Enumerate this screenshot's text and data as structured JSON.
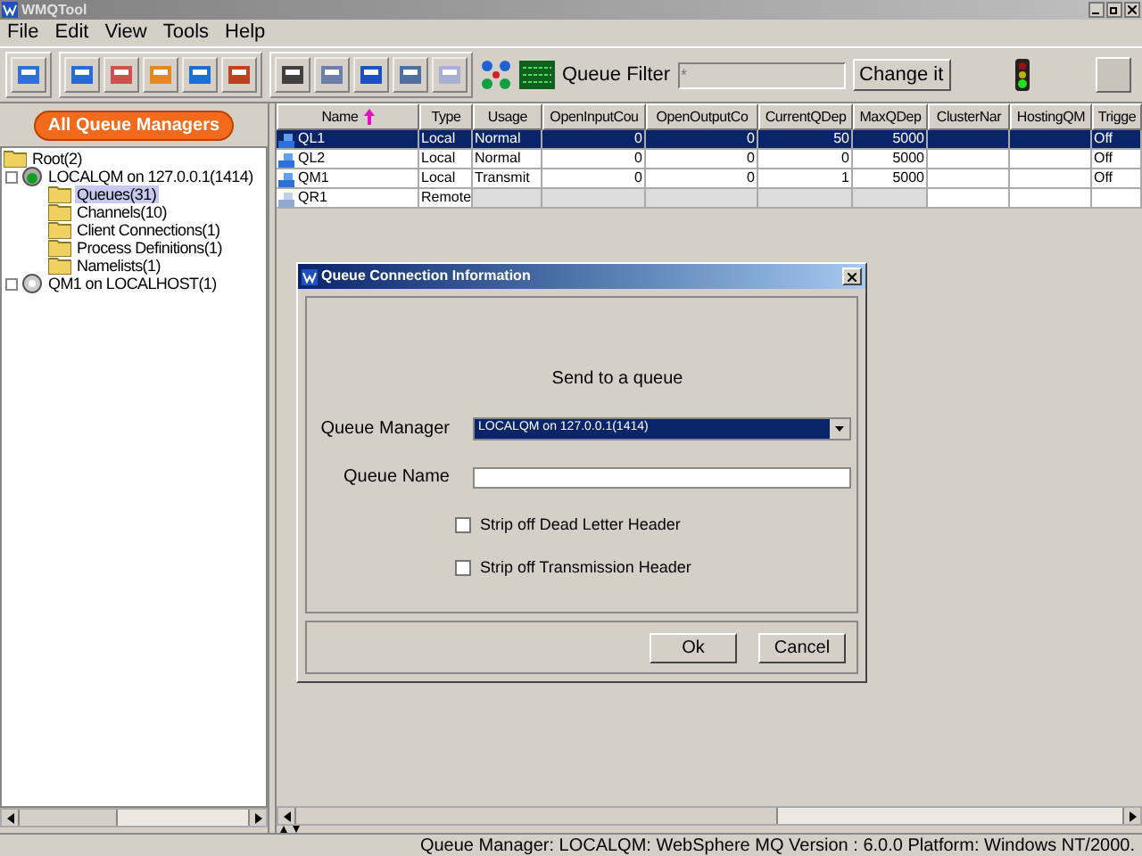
{
  "window": {
    "title": "WMQTool"
  },
  "menu": [
    "File",
    "Edit",
    "View",
    "Tools",
    "Help"
  ],
  "queue_filter": {
    "label": "Queue Filter",
    "value": "*",
    "button": "Change it"
  },
  "left_panel": {
    "button": "All Queue Managers",
    "tree": [
      {
        "label": "Root(2)",
        "kind": "folder",
        "selected": false,
        "children": [
          {
            "label": "LOCALQM on 127.0.0.1(1414)",
            "kind": "manager-running",
            "selected": false,
            "children": [
              {
                "label": "Queues(31)",
                "kind": "folder",
                "selected": true
              },
              {
                "label": "Channels(10)",
                "kind": "folder",
                "selected": false
              },
              {
                "label": "Client Connections(1)",
                "kind": "folder",
                "selected": false
              },
              {
                "label": "Process Definitions(1)",
                "kind": "folder",
                "selected": false
              },
              {
                "label": "Namelists(1)",
                "kind": "folder",
                "selected": false
              }
            ]
          },
          {
            "label": "QM1 on LOCALHOST(1)",
            "kind": "manager",
            "selected": false
          }
        ]
      }
    ]
  },
  "table": {
    "columns": [
      {
        "label": "Name",
        "sorted": true
      },
      {
        "label": "Type",
        "sorted": false
      },
      {
        "label": "Usage",
        "sorted": false
      },
      {
        "label": "OpenInputCou",
        "sorted": false
      },
      {
        "label": "OpenOutputCo",
        "sorted": false
      },
      {
        "label": "CurrentQDep",
        "sorted": false
      },
      {
        "label": "MaxQDep",
        "sorted": false
      },
      {
        "label": "ClusterNar",
        "sorted": false
      },
      {
        "label": "HostingQM",
        "sorted": false
      },
      {
        "label": "Trigge",
        "sorted": false
      }
    ],
    "rows": [
      {
        "kind": "local",
        "selected": true,
        "cells": [
          "QL1",
          "Local",
          "Normal",
          "0",
          "0",
          "50",
          "5000",
          "",
          "",
          "Off"
        ]
      },
      {
        "kind": "local",
        "selected": false,
        "cells": [
          "QL2",
          "Local",
          "Normal",
          "0",
          "0",
          "0",
          "5000",
          "",
          "",
          "Off"
        ]
      },
      {
        "kind": "local",
        "selected": false,
        "cells": [
          "QM1",
          "Local",
          "Transmit",
          "0",
          "0",
          "1",
          "5000",
          "",
          "",
          "Off"
        ]
      },
      {
        "kind": "remote",
        "selected": false,
        "cells": [
          "QR1",
          "Remote",
          "",
          "",
          "",
          "",
          "",
          "",
          "",
          ""
        ]
      }
    ]
  },
  "dialog": {
    "title": "Queue Connection Information",
    "heading": "Send to a queue",
    "queue_manager": {
      "label": "Queue Manager",
      "value": "LOCALQM on 127.0.0.1(1414)"
    },
    "queue_name": {
      "label": "Queue Name"
    },
    "checkboxes": [
      {
        "label": "Strip off Dead Letter Header",
        "checked": false
      },
      {
        "label": "Strip off Transmission Header",
        "checked": false
      }
    ],
    "buttons": [
      "Ok",
      "Cancel"
    ]
  },
  "status_bar": "Queue Manager: LOCALQM: WebSphere MQ Version : 6.0.0 Platform: Windows NT/2000."
}
